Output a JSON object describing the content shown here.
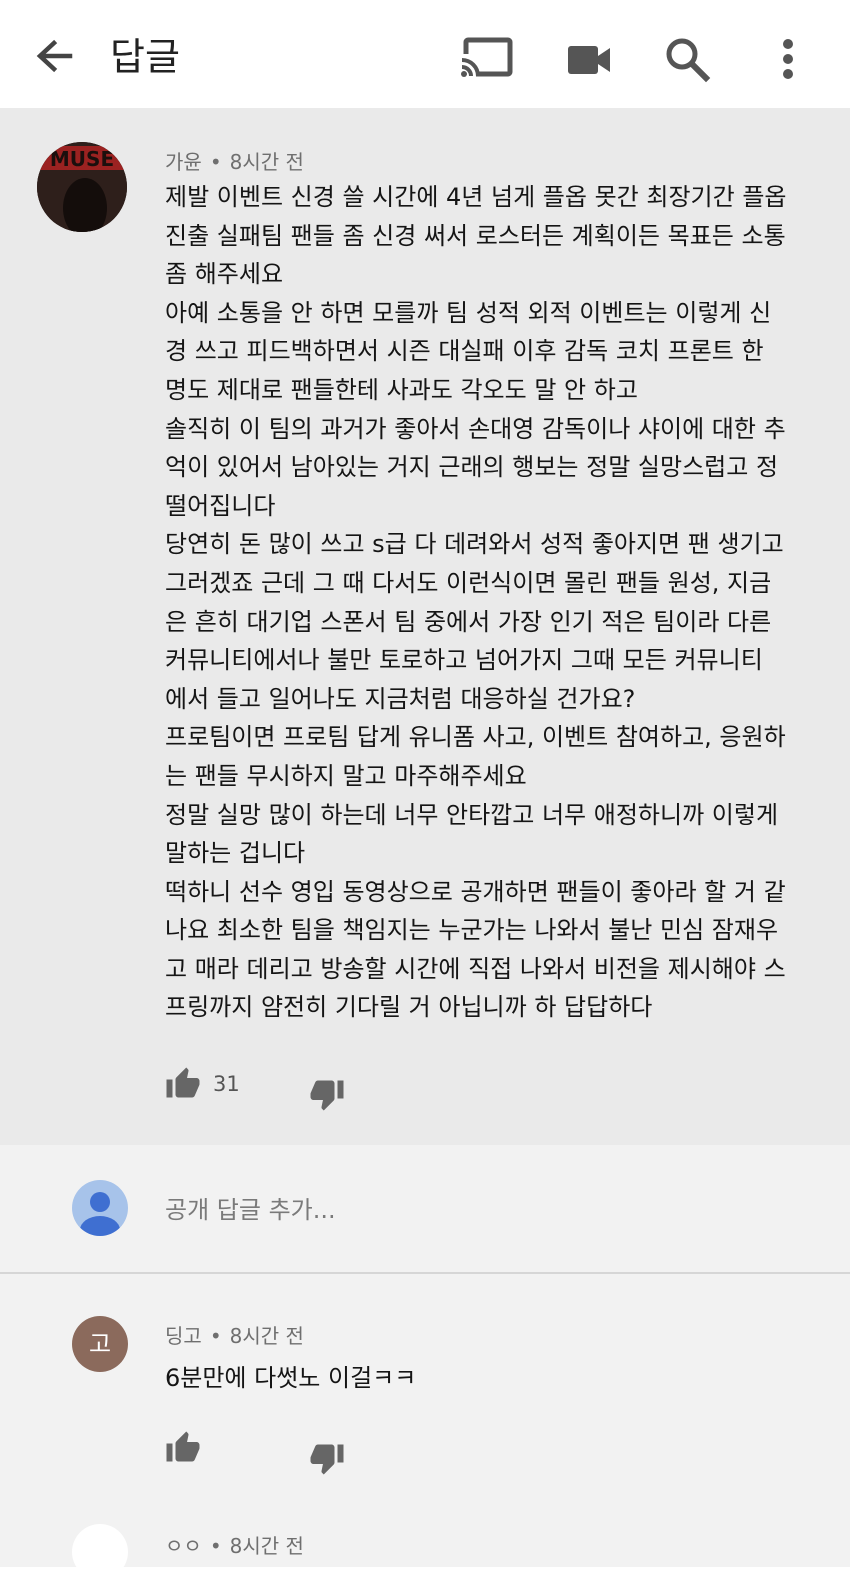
{
  "header": {
    "title": "답글"
  },
  "comment": {
    "author": "가윤",
    "time": "8시간 전",
    "body": "제발 이벤트 신경 쓸 시간에 4년 넘게 플옵 못간 최장기간 플옵\n진출 실패팀 팬들 좀 신경 써서 로스터든 계획이든 목표든 소통\n좀 해주세요\n아예 소통을 안 하면 모를까 팀 성적 외적 이벤트는 이렇게 신\n경 쓰고 피드백하면서 시즌 대실패 이후 감독 코치 프론트 한\n명도 제대로 팬들한테 사과도 각오도 말 안 하고\n솔직히 이 팀의 과거가 좋아서 손대영 감독이나 샤이에 대한 추\n억이 있어서 남아있는 거지 근래의 행보는 정말 실망스럽고 정\n떨어집니다\n당연히 돈 많이 쓰고 s급 다 데려와서 성적 좋아지면 팬 생기고\n그러겠죠 근데 그 때 다서도 이런식이면 몰린 팬들 원성, 지금\n은 흔히 대기업 스폰서 팀 중에서 가장 인기 적은 팀이라 다른\n커뮤니티에서나 불만 토로하고 넘어가지 그때 모든 커뮤니티\n에서 들고 일어나도 지금처럼 대응하실 건가요?\n프로팀이면 프로팀 답게 유니폼 사고, 이벤트 참여하고, 응원하\n는 팬들 무시하지 말고 마주해주세요\n정말 실망 많이 하는데 너무 안타깝고 너무 애정하니까 이렇게\n말하는 겁니다\n떡하니 선수 영입 동영상으로 공개하면 팬들이 좋아라 할 거 같\n나요 최소한 팀을 책임지는 누군가는 나와서 불난 민심 잠재우\n고 매라 데리고 방송할 시간에 직접 나와서 비전을 제시해야 스\n프링까지 얌전히 기다릴 거 아닙니까 하 답답하다",
    "likes": "31",
    "avatar_text": "MUSE"
  },
  "reply_input": {
    "placeholder": "공개 답글 추가..."
  },
  "replies": [
    {
      "author": "딩고",
      "time": "8시간 전",
      "avatar_letter": "고",
      "body": "6분만에 다썻노 이걸ㅋㅋ"
    },
    {
      "author": "ㅇㅇ",
      "time": "8시간 전"
    }
  ],
  "colors": {
    "thread_bg": "#eaeaea",
    "reply_bg": "#f2f2f2",
    "meta_text": "#6f6f6f"
  },
  "icons": [
    "back-arrow-icon",
    "cast-icon",
    "video-camera-icon",
    "search-icon",
    "more-vert-icon",
    "thumb-up-icon",
    "thumb-down-icon"
  ]
}
